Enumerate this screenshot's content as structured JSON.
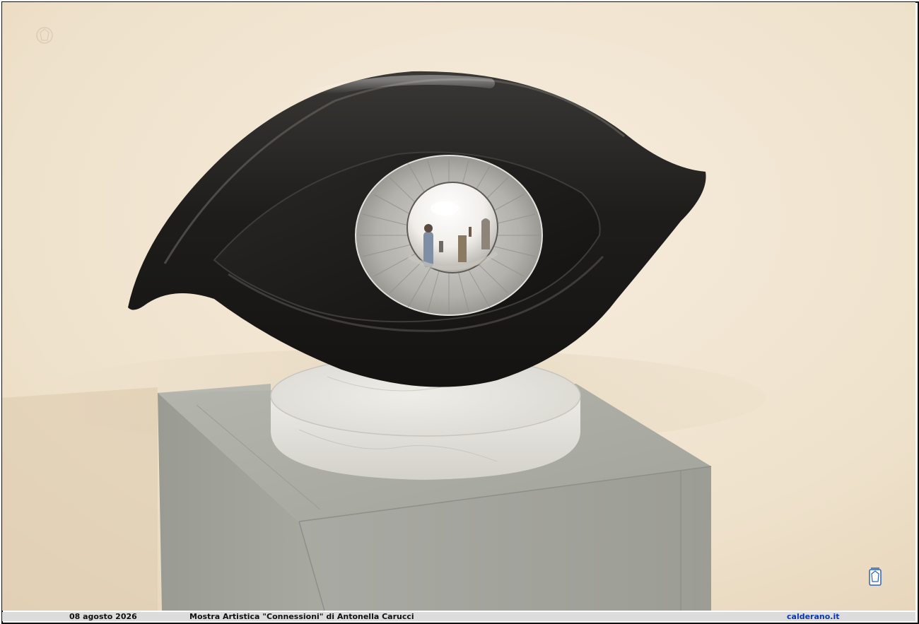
{
  "caption": {
    "date": "08 agosto 2026",
    "title": "Mostra Artistica \"Connessioni\" di Antonella Carucci",
    "site": "calderano.it"
  },
  "photo": {
    "subject": "eye-sculpture-icon",
    "colors": {
      "wall": "#efe2cc",
      "sculpture": "#1c1b19",
      "iris": "#b9b7b2",
      "pedestal": "#a9aaa2",
      "marble_base": "#e4e2dc",
      "site_link": "#0b36a8"
    }
  }
}
